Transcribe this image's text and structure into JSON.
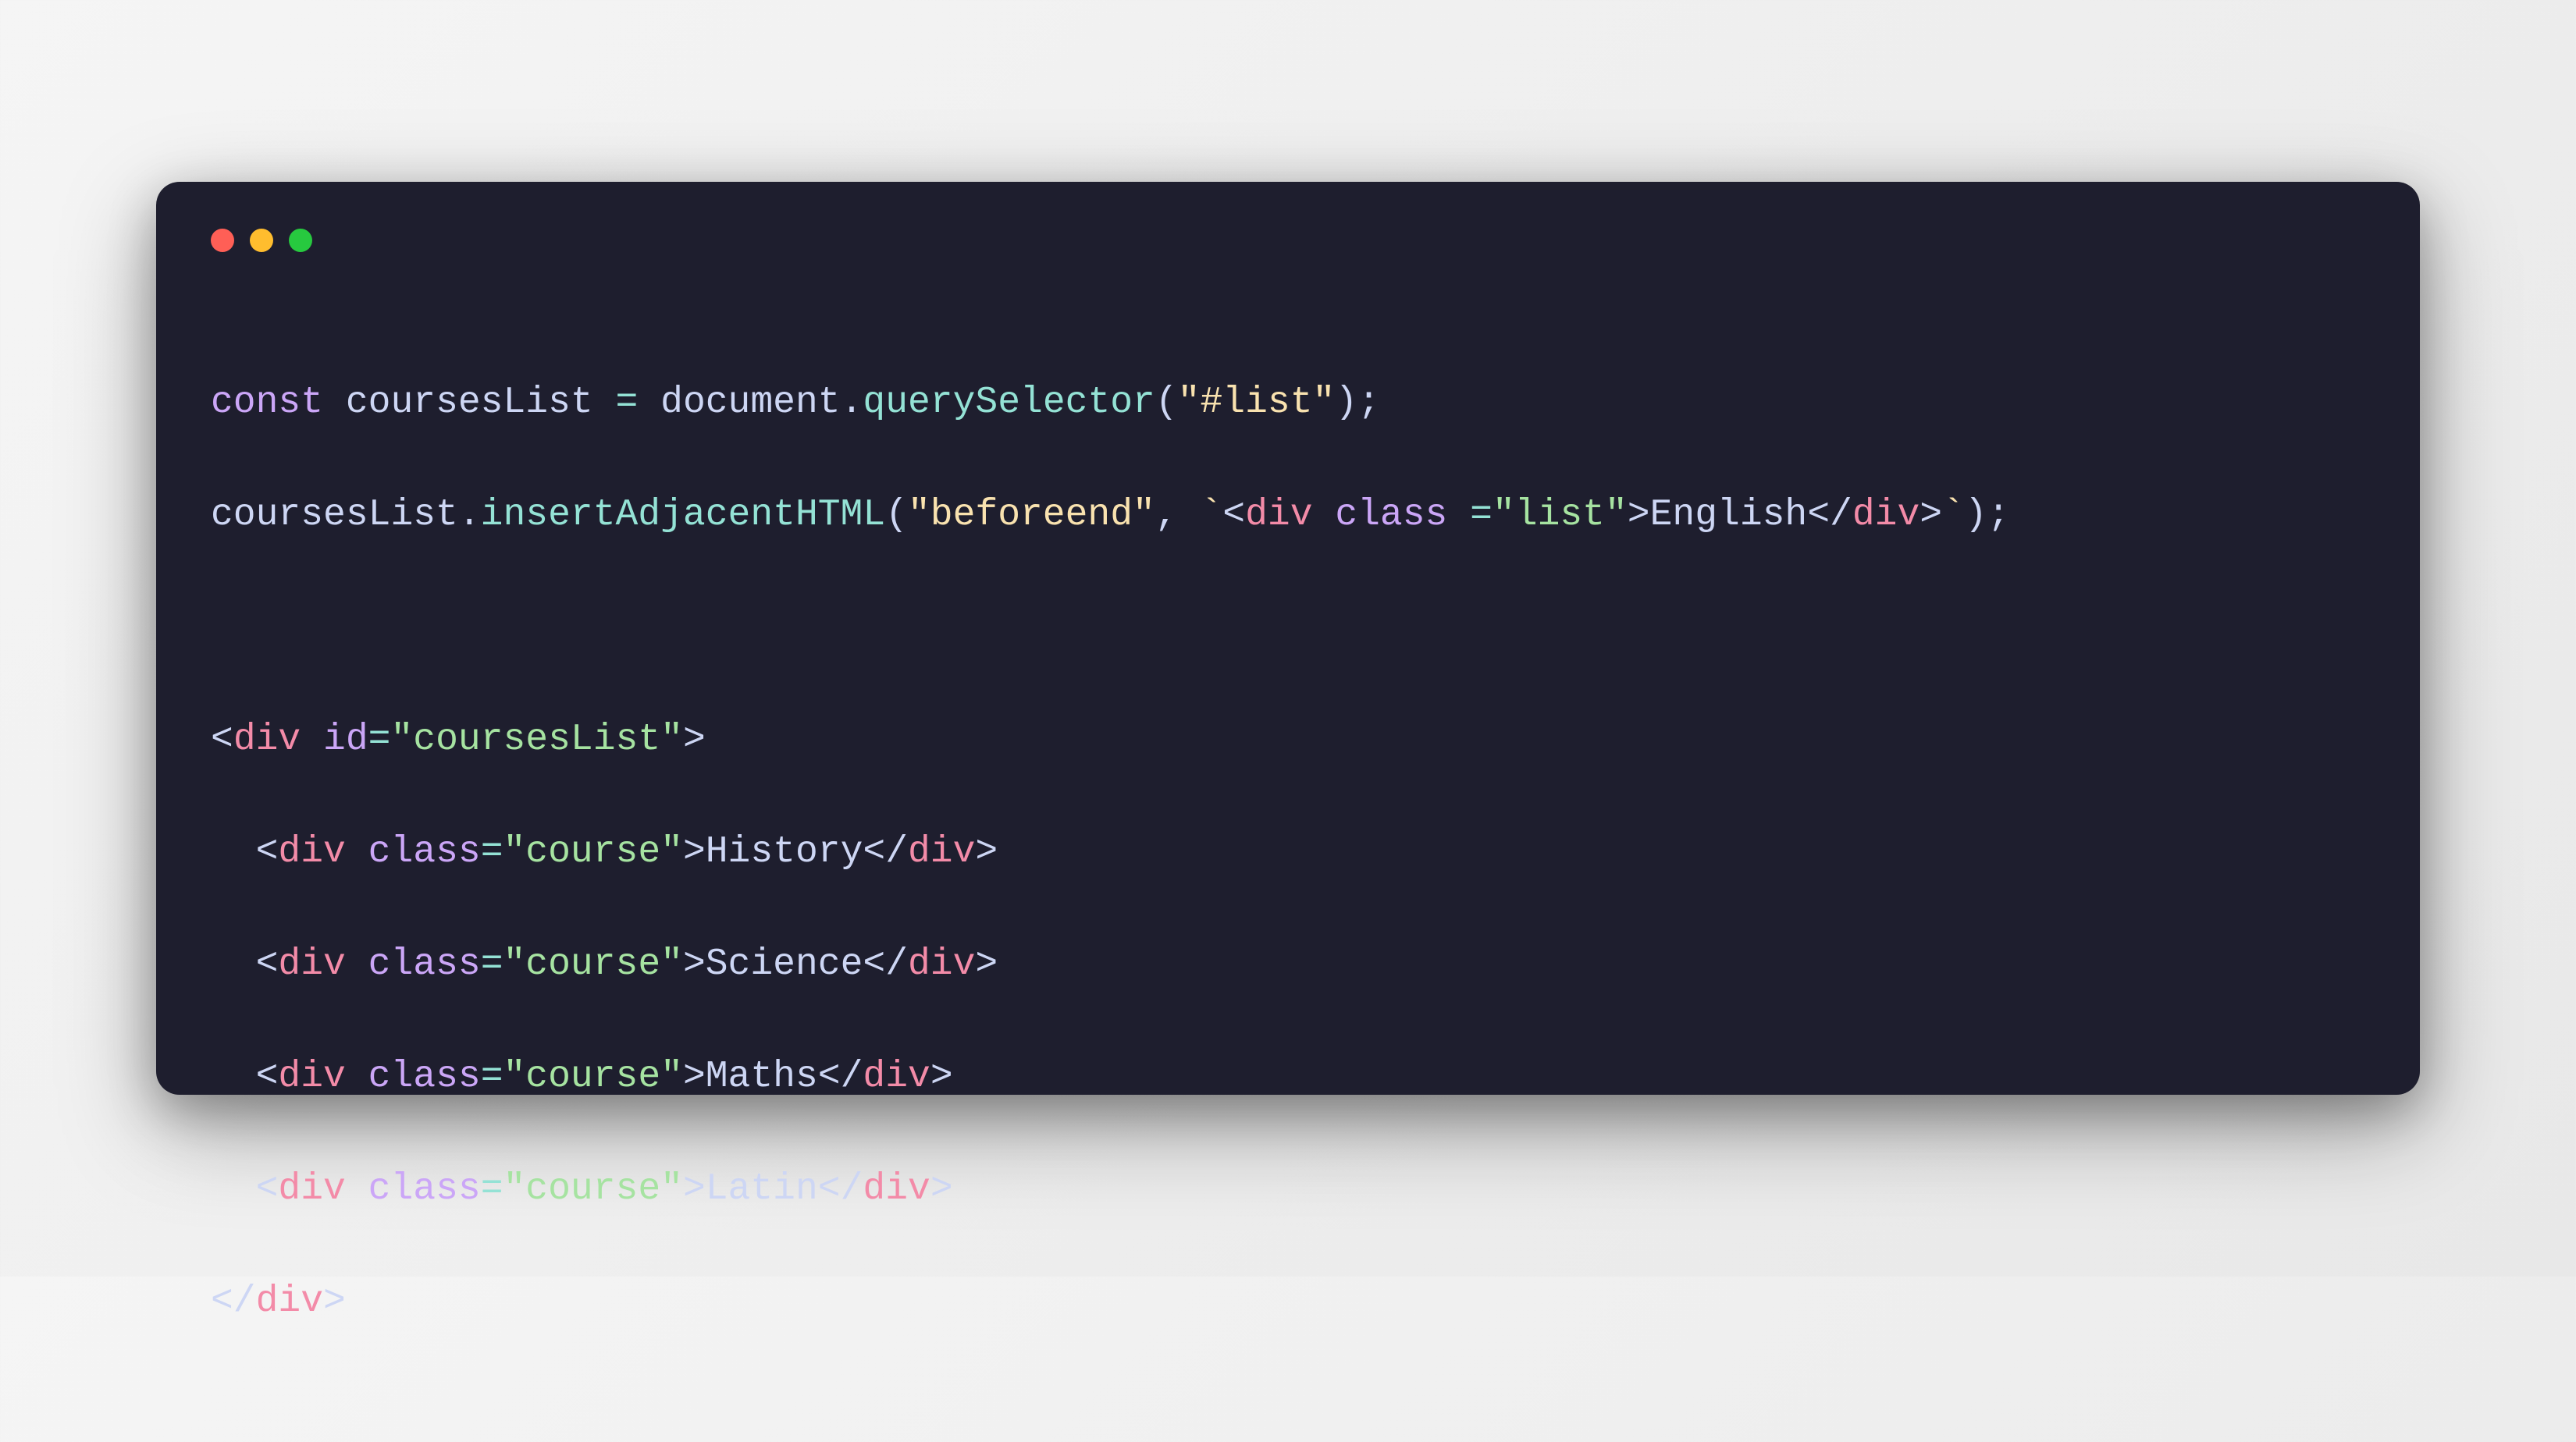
{
  "window": {
    "traffic_lights": {
      "red": "#ff5f56",
      "yellow": "#ffbd2e",
      "green": "#27c93f"
    }
  },
  "code": {
    "line1": {
      "keyword": "const",
      "variable": "coursesList",
      "operator": "=",
      "object": "document",
      "method": "querySelector",
      "arg_string": "\"#list\"",
      "semicolon": ";"
    },
    "line2": {
      "object": "coursesList",
      "method": "insertAdjacentHTML",
      "arg1_string": "\"beforeend\"",
      "comma": ",",
      "backtick_open": "`",
      "tag_open_bracket": "<",
      "tag_name": "div",
      "attr_name": "class",
      "attr_equals": " =",
      "attr_value": "\"list\"",
      "tag_close_bracket": ">",
      "text_content": "English",
      "close_tag_open": "</",
      "close_tag_name": "div",
      "close_tag_bracket": ">",
      "backtick_close": "`",
      "paren_close": ")",
      "semicolon": ";"
    },
    "line4": {
      "open_bracket": "<",
      "tag_name": "div",
      "attr_name": "id",
      "attr_equals": "=",
      "attr_value": "\"coursesList\"",
      "close_bracket": ">"
    },
    "line5": {
      "indent": "  ",
      "open_bracket": "<",
      "tag_name": "div",
      "attr_name": "class",
      "attr_equals": "=",
      "attr_value": "\"course\"",
      "close_bracket": ">",
      "text": "History",
      "close_open": "</",
      "close_tag": "div",
      "close_close": ">"
    },
    "line6": {
      "indent": "  ",
      "open_bracket": "<",
      "tag_name": "div",
      "attr_name": "class",
      "attr_equals": "=",
      "attr_value": "\"course\"",
      "close_bracket": ">",
      "text": "Science",
      "close_open": "</",
      "close_tag": "div",
      "close_close": ">"
    },
    "line7": {
      "indent": "  ",
      "open_bracket": "<",
      "tag_name": "div",
      "attr_name": "class",
      "attr_equals": "=",
      "attr_value": "\"course\"",
      "close_bracket": ">",
      "text": "Maths",
      "close_open": "</",
      "close_tag": "div",
      "close_close": ">"
    },
    "line8": {
      "indent": "  ",
      "open_bracket": "<",
      "tag_name": "div",
      "attr_name": "class",
      "attr_equals": "=",
      "attr_value": "\"course\"",
      "close_bracket": ">",
      "text": "Latin",
      "close_open": "</",
      "close_tag": "div",
      "close_close": ">"
    },
    "line9": {
      "close_open": "</",
      "close_tag": "div",
      "close_close": ">"
    }
  }
}
